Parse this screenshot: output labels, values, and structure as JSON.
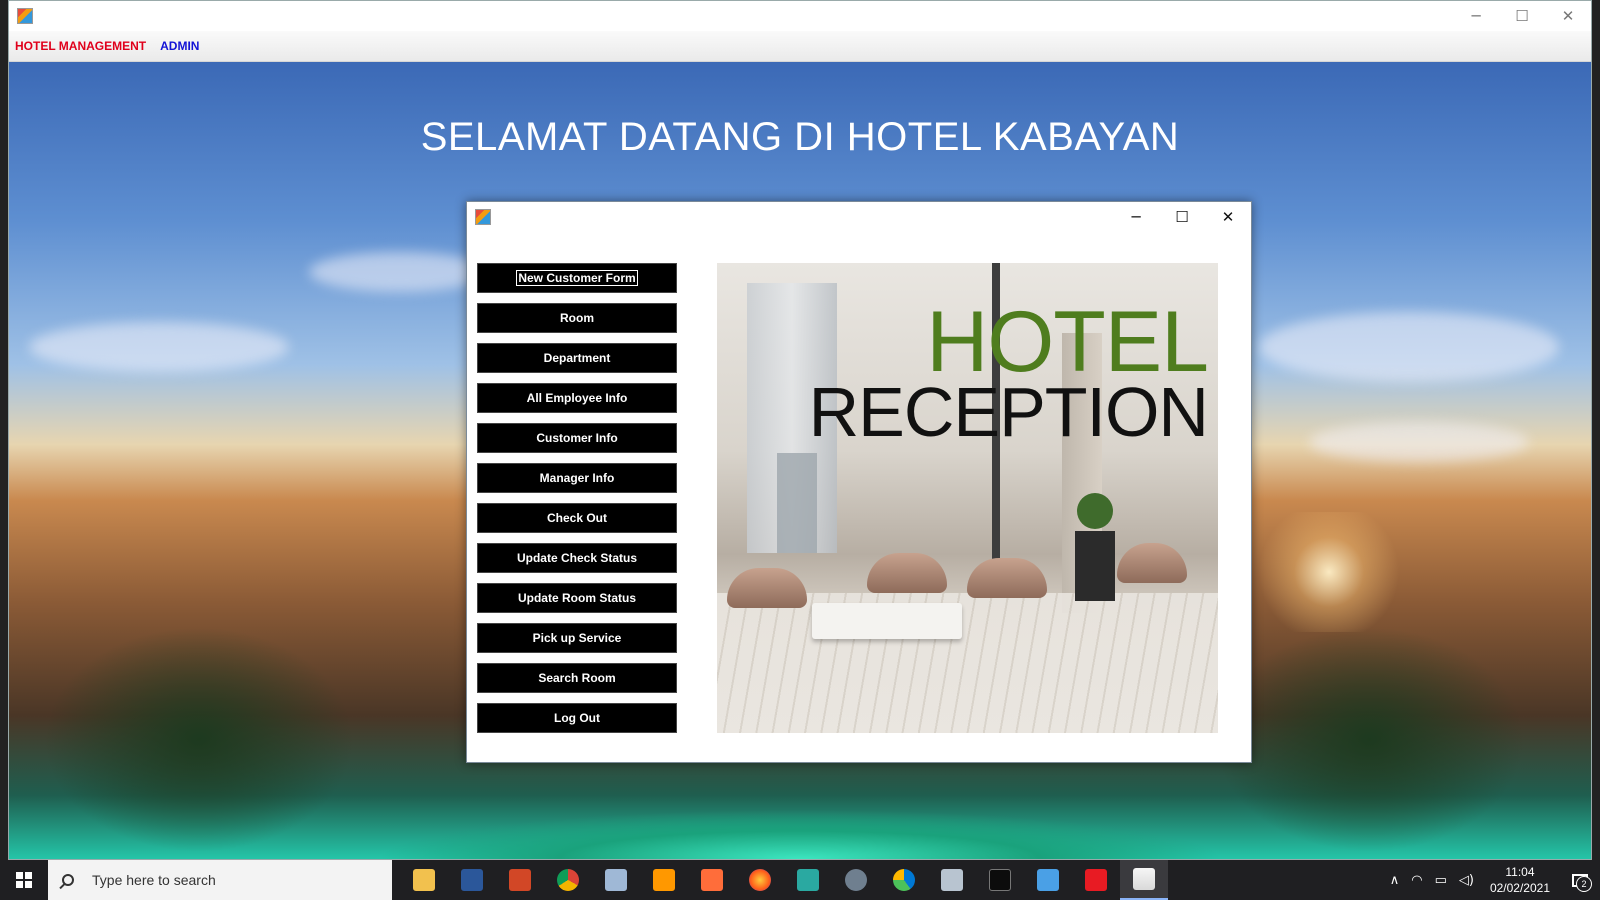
{
  "colors": {
    "menu_hotel_management": "#e0001b",
    "menu_admin": "#1212d6",
    "hotel_word": "#4f7d1e",
    "button_bg": "#000000"
  },
  "menu": {
    "hotel_management": "HOTEL MANAGEMENT",
    "admin": "ADMIN"
  },
  "welcome_text": "SELAMAT DATANG DI HOTEL KABAYAN",
  "dialog": {
    "buttons": [
      "New Customer Form",
      "Room",
      "Department",
      "All Employee Info",
      "Customer Info",
      "Manager Info",
      "Check Out",
      "Update Check Status",
      "Update Room Status",
      "Pick up Service",
      "Search Room",
      "Log Out"
    ],
    "image": {
      "line1": "HOTEL",
      "line2": "RECEPTION"
    }
  },
  "window_controls": {
    "minimize": "─",
    "maximize": "☐",
    "close": "✕"
  },
  "taskbar": {
    "search_placeholder": "Type here to search",
    "apps": [
      "file-explorer-icon",
      "word-icon",
      "powerpoint-icon",
      "chrome-icon",
      "app-cube-icon",
      "sublime-icon",
      "app-orange-icon",
      "firefox-icon",
      "installer-icon",
      "app-person-icon",
      "edge-icon",
      "app-monitor-icon",
      "terminal-icon",
      "control-panel-icon",
      "acrobat-icon",
      "java-icon"
    ],
    "time": "11:04",
    "date": "02/02/2021",
    "notification_count": "2"
  }
}
